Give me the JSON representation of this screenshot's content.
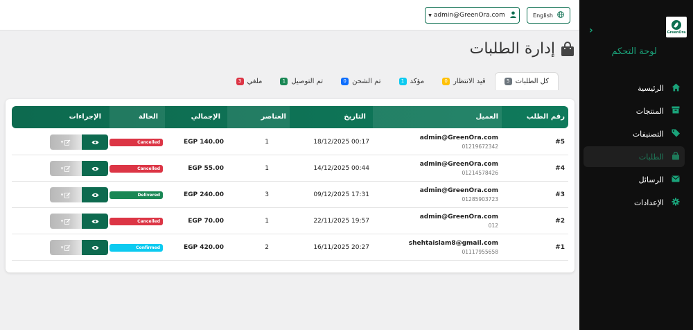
{
  "sidebar": {
    "logo_text": "GreenOra",
    "title": "لوحة التحكم",
    "items": [
      {
        "label": "الرئيسية",
        "icon": "home-icon",
        "active": false
      },
      {
        "label": "المنتجات",
        "icon": "box-icon",
        "active": false
      },
      {
        "label": "التصنيفات",
        "icon": "tags-icon",
        "active": false
      },
      {
        "label": "الطلبات",
        "icon": "shopping-bag-icon",
        "active": true
      },
      {
        "label": "الرسائل",
        "icon": "envelope-icon",
        "active": false
      },
      {
        "label": "الإعدادات",
        "icon": "gear-icon",
        "active": false
      }
    ]
  },
  "topbar": {
    "language_label": "English",
    "user_email": "admin@GreenOra.com"
  },
  "page": {
    "title": "إدارة الطلبات"
  },
  "tabs": [
    {
      "label": "كل الطلبات",
      "count": "5",
      "color": "#6c757d",
      "active": true
    },
    {
      "label": "قيد الانتظار",
      "count": "0",
      "color": "#ffc107",
      "active": false
    },
    {
      "label": "مؤكد",
      "count": "1",
      "color": "#0dcaf0",
      "active": false
    },
    {
      "label": "تم الشحن",
      "count": "0",
      "color": "#0d6efd",
      "active": false
    },
    {
      "label": "تم التوصيل",
      "count": "1",
      "color": "#198754",
      "active": false
    },
    {
      "label": "ملغي",
      "count": "3",
      "color": "#dc3545",
      "active": false
    }
  ],
  "table": {
    "headers": {
      "order_no": "رقم الطلب",
      "customer": "العميل",
      "date": "التاريخ",
      "items": "العناصر",
      "total": "الإجمالي",
      "status": "الحالة",
      "actions": "الإجراءات"
    },
    "rows": [
      {
        "order_no": "#5",
        "email": "admin@GreenOra.com",
        "phone": "01219672342",
        "date": "18/12/2025 00:17",
        "items": "1",
        "total": "EGP 140.00",
        "status": "Cancelled",
        "status_color": "#dc3545"
      },
      {
        "order_no": "#4",
        "email": "admin@GreenOra.com",
        "phone": "01214578426",
        "date": "14/12/2025 00:44",
        "items": "1",
        "total": "EGP 55.00",
        "status": "Cancelled",
        "status_color": "#dc3545"
      },
      {
        "order_no": "#3",
        "email": "admin@GreenOra.com",
        "phone": "01285903723",
        "date": "09/12/2025 17:31",
        "items": "3",
        "total": "EGP 240.00",
        "status": "Delivered",
        "status_color": "#198754"
      },
      {
        "order_no": "#2",
        "email": "admin@GreenOra.com",
        "phone": "012",
        "date": "22/11/2025 19:57",
        "items": "1",
        "total": "EGP 70.00",
        "status": "Cancelled",
        "status_color": "#dc3545"
      },
      {
        "order_no": "#1",
        "email": "shehtaislam8@gmail.com",
        "phone": "01117955658",
        "date": "16/11/2025 20:27",
        "items": "2",
        "total": "EGP 420.00",
        "status": "Confirmed",
        "status_color": "#0dcaf0"
      }
    ]
  },
  "colors": {
    "accent": "#0d6a4f",
    "sidebar_bg": "#0f0f0f",
    "sidebar_accent": "#1aa37a"
  }
}
